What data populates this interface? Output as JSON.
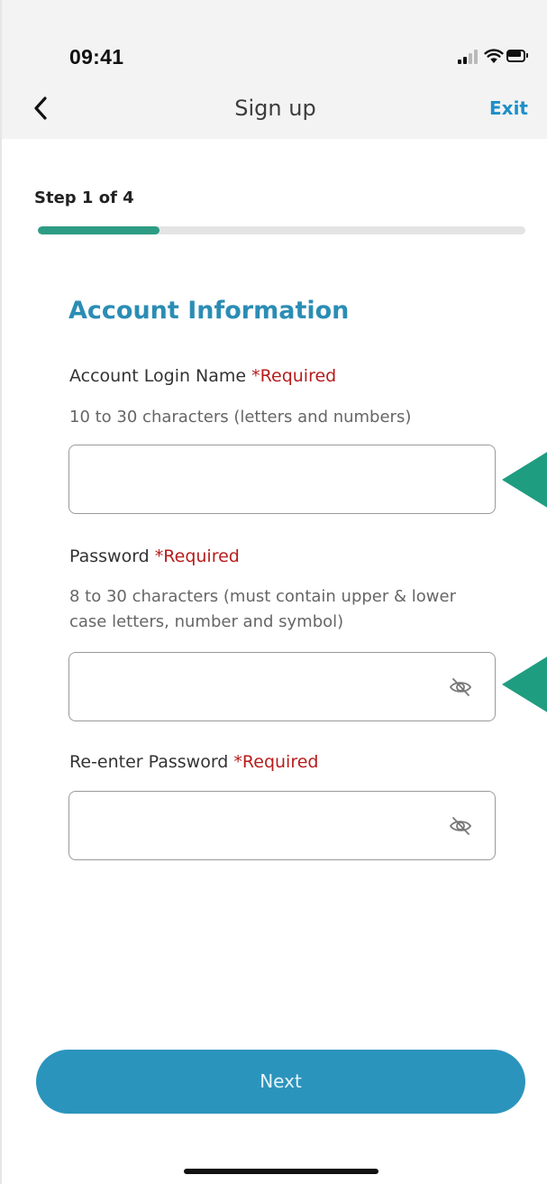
{
  "status_bar": {
    "time": "09:41"
  },
  "nav": {
    "title": "Sign up",
    "exit_label": "Exit"
  },
  "progress": {
    "step_label": "Step 1 of 4",
    "fraction": 0.25
  },
  "form": {
    "section_title": "Account Information",
    "login_name": {
      "label": "Account Login Name ",
      "required": "*Required",
      "hint": "10 to 30 characters (letters and numbers)",
      "value": ""
    },
    "password": {
      "label": "Password ",
      "required": "*Required",
      "hint": "8 to 30 characters (must contain upper & lower case letters, number and symbol)",
      "value": ""
    },
    "reenter_password": {
      "label": "Re-enter Password  ",
      "required": "*Required",
      "value": ""
    }
  },
  "next_button": {
    "label": "Next"
  },
  "colors": {
    "accent": "#2b94bd",
    "section_title": "#2b8db4",
    "progress": "#2e9c84",
    "required": "#b71c1c",
    "exit": "#1d8fc9",
    "marker": "#1f9d80"
  },
  "icons": {
    "back": "chevron-left-icon",
    "signal": "signal-icon",
    "wifi": "wifi-icon",
    "battery": "battery-icon",
    "password_toggle": "eye-off-icon"
  }
}
